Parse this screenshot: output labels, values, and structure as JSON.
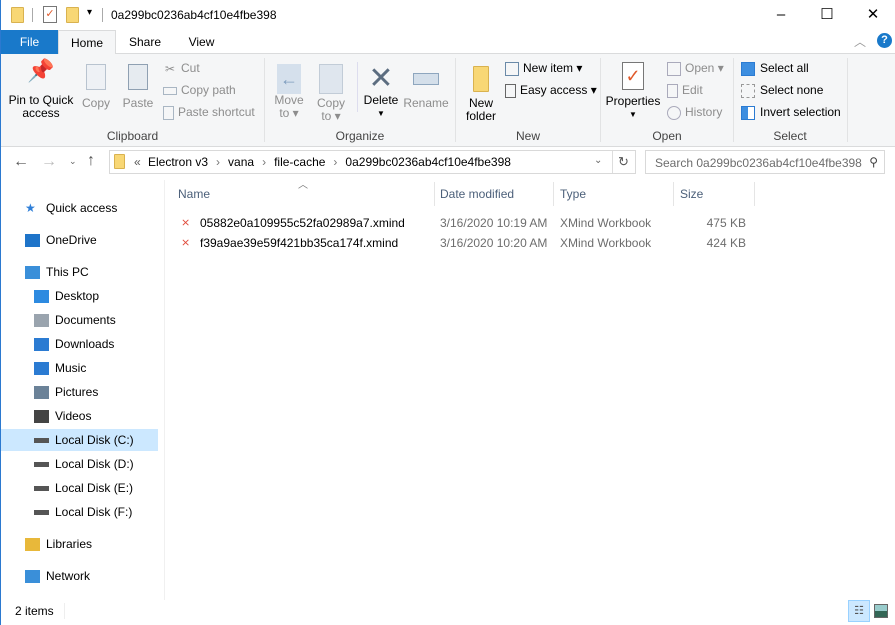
{
  "window": {
    "title": "0a299bc0236ab4cf10e4fbe398",
    "minimize": "–",
    "maximize": "☐",
    "close": "✕"
  },
  "tabs": [
    {
      "label": "File"
    },
    {
      "label": "Home"
    },
    {
      "label": "Share"
    },
    {
      "label": "View"
    }
  ],
  "ribbon": {
    "clipboard": {
      "label": "Clipboard",
      "pin": "Pin to Quick access",
      "pin1": "Pin to Quick",
      "pin2": "access",
      "copy": "Copy",
      "paste": "Paste",
      "cut": "Cut",
      "copy_path": "Copy path",
      "paste_shortcut": "Paste shortcut"
    },
    "organize": {
      "label": "Organize",
      "move1": "Move",
      "move2": "to",
      "copy1": "Copy",
      "copy2": "to",
      "delete": "Delete",
      "rename": "Rename"
    },
    "new": {
      "label": "New",
      "folder1": "New",
      "folder2": "folder",
      "new_item": "New item",
      "easy_access": "Easy access"
    },
    "open": {
      "label": "Open",
      "properties": "Properties",
      "open": "Open",
      "edit": "Edit",
      "history": "History"
    },
    "select": {
      "label": "Select",
      "all": "Select all",
      "none": "Select none",
      "invert": "Invert selection"
    }
  },
  "address": {
    "overflow": "«",
    "crumbs": [
      "Electron v3",
      "vana",
      "file-cache",
      "0a299bc0236ab4cf10e4fbe398"
    ],
    "search_placeholder": "Search 0a299bc0236ab4cf10e4fbe398"
  },
  "nav": [
    {
      "label": "Quick access",
      "icon": "star-icon",
      "color": "#2f7fd8"
    },
    {
      "label": "OneDrive",
      "icon": "cloud-icon",
      "color": "#1e74c9"
    },
    {
      "label": "This PC",
      "icon": "computer-icon",
      "color": "#3a8fd9"
    },
    {
      "label": "Desktop",
      "icon": "desktop-icon",
      "color": "#2d8ae0"
    },
    {
      "label": "Documents",
      "icon": "documents-icon",
      "color": "#9aa4ae"
    },
    {
      "label": "Downloads",
      "icon": "download-icon",
      "color": "#2b7bd2"
    },
    {
      "label": "Music",
      "icon": "music-icon",
      "color": "#2b7bd2"
    },
    {
      "label": "Pictures",
      "icon": "pictures-icon",
      "color": "#6b8298"
    },
    {
      "label": "Videos",
      "icon": "videos-icon",
      "color": "#444"
    },
    {
      "label": "Local Disk (C:)",
      "icon": "drive-icon",
      "color": "#555",
      "selected": true
    },
    {
      "label": "Local Disk (D:)",
      "icon": "drive-icon",
      "color": "#555"
    },
    {
      "label": "Local Disk (E:)",
      "icon": "drive-icon",
      "color": "#555"
    },
    {
      "label": "Local Disk (F:)",
      "icon": "drive-icon",
      "color": "#555"
    },
    {
      "label": "Libraries",
      "icon": "libraries-icon",
      "color": "#e8b83a"
    },
    {
      "label": "Network",
      "icon": "network-icon",
      "color": "#3a8fd9"
    }
  ],
  "columns": {
    "name": "Name",
    "date": "Date modified",
    "type": "Type",
    "size": "Size"
  },
  "files": [
    {
      "name": "05882e0a109955c52fa02989a7.xmind",
      "date": "3/16/2020 10:19 AM",
      "type": "XMind Workbook",
      "size": "475 KB"
    },
    {
      "name": "f39a9ae39e59f421bb35ca174f.xmind",
      "date": "3/16/2020 10:20 AM",
      "type": "XMind Workbook",
      "size": "424 KB"
    }
  ],
  "status": {
    "items": "2 items"
  },
  "colors": {
    "accent": "#1979ca",
    "selected": "#cce8ff"
  }
}
